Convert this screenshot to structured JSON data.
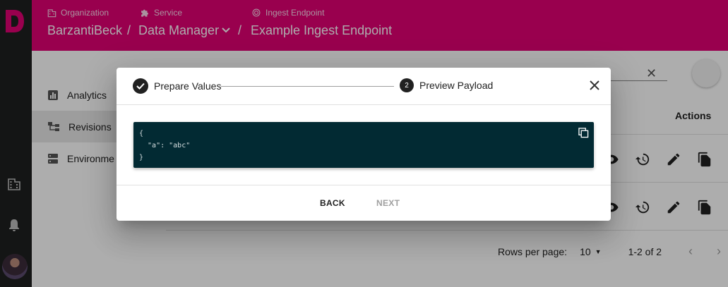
{
  "rail": {
    "logo_letter": "D"
  },
  "header": {
    "labels": {
      "organization": "Organization",
      "service": "Service",
      "endpoint": "Ingest Endpoint"
    },
    "path": {
      "organization": "BarzantiBeck",
      "sep1": "/",
      "service": "Data Manager",
      "sep2": "/",
      "endpoint": "Example Ingest Endpoint"
    }
  },
  "side_menu": {
    "items": [
      {
        "label": "Analytics",
        "icon": "chart-icon"
      },
      {
        "label": "Revisions",
        "icon": "tree-icon"
      },
      {
        "label": "Environme",
        "icon": "server-icon"
      }
    ]
  },
  "table": {
    "actions_header": "Actions"
  },
  "pager": {
    "rows_label": "Rows per page:",
    "rows_value": "10",
    "range": "1-2 of 2"
  },
  "dialog": {
    "steps": [
      {
        "label": "Prepare Values",
        "state": "done"
      },
      {
        "label": "Preview Payload",
        "number": "2",
        "state": "active"
      }
    ],
    "code_lines": [
      "{",
      "  \"a\": \"abc\"",
      "}"
    ],
    "back_label": "BACK",
    "next_label": "NEXT"
  },
  "colors": {
    "brand": "#e20074",
    "rail": "#1e2020",
    "code_bg": "#022a33"
  }
}
